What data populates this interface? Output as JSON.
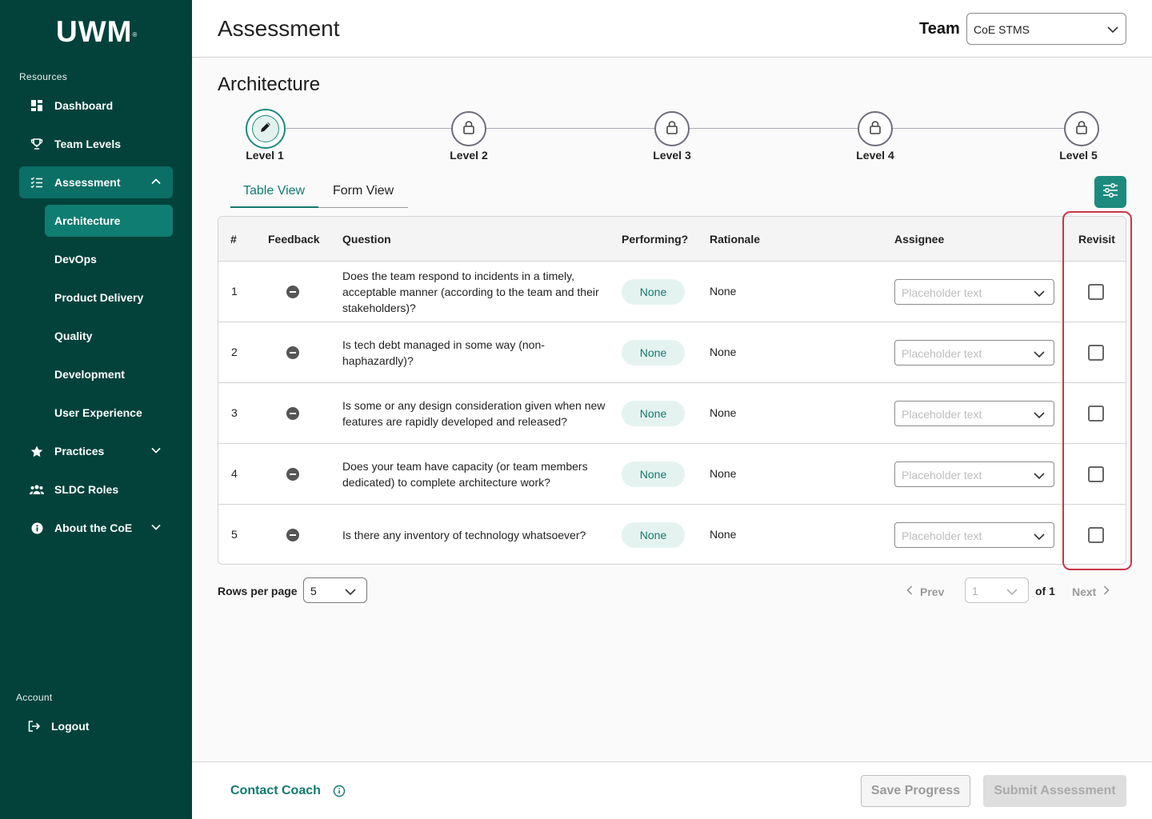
{
  "app": {
    "logo_text": "UWM",
    "logo_mark": "®"
  },
  "sidebar": {
    "resources_label": "Resources",
    "items": [
      {
        "label": "Dashboard",
        "icon": "dashboard-icon"
      },
      {
        "label": "Team Levels",
        "icon": "trophy-icon"
      },
      {
        "label": "Assessment",
        "icon": "checklist-icon",
        "expanded": true
      },
      {
        "label": "Practices",
        "icon": "star-icon"
      },
      {
        "label": "SLDC Roles",
        "icon": "people-icon"
      },
      {
        "label": "About the CoE",
        "icon": "info-icon"
      }
    ],
    "assessment_subitems": [
      {
        "label": "Architecture",
        "active": true
      },
      {
        "label": "DevOps"
      },
      {
        "label": "Product Delivery"
      },
      {
        "label": "Quality"
      },
      {
        "label": "Development"
      },
      {
        "label": "User Experience"
      }
    ],
    "account_label": "Account",
    "logout_label": "Logout"
  },
  "header": {
    "title": "Assessment",
    "team_label": "Team",
    "team_value": "CoE STMS"
  },
  "section": {
    "title": "Architecture"
  },
  "stepper": {
    "levels": [
      {
        "label": "Level 1",
        "state": "current"
      },
      {
        "label": "Level 2",
        "state": "locked"
      },
      {
        "label": "Level 3",
        "state": "locked"
      },
      {
        "label": "Level 4",
        "state": "locked"
      },
      {
        "label": "Level 5",
        "state": "locked"
      }
    ]
  },
  "tabs": [
    {
      "label": "Table View",
      "active": true
    },
    {
      "label": "Form View"
    }
  ],
  "table": {
    "headers": {
      "num": "#",
      "feedback": "Feedback",
      "question": "Question",
      "performing": "Performing?",
      "rationale": "Rationale",
      "assignee": "Assignee",
      "revisit": "Revisit"
    },
    "rows": [
      {
        "num": "1",
        "question": "Does the team respond to incidents in a timely, acceptable manner (according to the team and their stakeholders)?",
        "performing": "None",
        "rationale": "None",
        "assignee_placeholder": "Placeholder text",
        "revisit": false
      },
      {
        "num": "2",
        "question": "Is tech debt managed in some way (non-haphazardly)?",
        "performing": "None",
        "rationale": "None",
        "assignee_placeholder": "Placeholder text",
        "revisit": false
      },
      {
        "num": "3",
        "question": "Is some or any design consideration given when new features are rapidly developed and released?",
        "performing": "None",
        "rationale": "None",
        "assignee_placeholder": "Placeholder text",
        "revisit": false
      },
      {
        "num": "4",
        "question": "Does your team have capacity (or team members dedicated) to complete architecture work?",
        "performing": "None",
        "rationale": "None",
        "assignee_placeholder": "Placeholder text",
        "revisit": false
      },
      {
        "num": "5",
        "question": "Is there any inventory of technology whatsoever?",
        "performing": "None",
        "rationale": "None",
        "assignee_placeholder": "Placeholder text",
        "revisit": false
      }
    ]
  },
  "pagination": {
    "rows_per_page_label": "Rows per page",
    "rows_per_page_value": "5",
    "prev_label": "Prev",
    "page_value": "1",
    "of_label": "of 1",
    "next_label": "Next"
  },
  "footer": {
    "contact_label": "Contact Coach",
    "save_label": "Save Progress",
    "submit_label": "Submit Assessment"
  },
  "colors": {
    "sidebar_bg": "#02423b",
    "accent": "#127a6f",
    "highlight": "#cc3545"
  }
}
